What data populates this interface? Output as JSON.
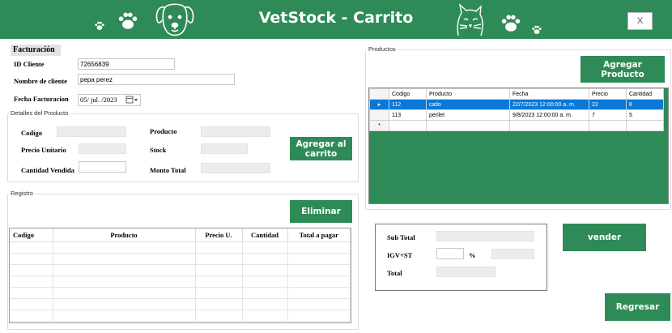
{
  "header": {
    "title": "VetStock - Carrito",
    "close_label": "X",
    "colors": {
      "accent": "#2e8b57",
      "selection": "#0a78d7"
    },
    "icons": [
      "paw-icon",
      "dog-face-icon",
      "cat-face-icon"
    ]
  },
  "facturacion": {
    "heading": "Facturación",
    "id_cliente_label": "ID Cliente",
    "id_cliente_value": "72656839",
    "nombre_label": "Nombre de cliente",
    "nombre_value": "pepa perez",
    "fecha_label": "Fecha Facturacion",
    "fecha_value": "05/ jul. /2023"
  },
  "detalles": {
    "group_title": "Detalles del Producto",
    "codigo_label": "Codigo",
    "precio_label": "Precio Unitario",
    "cantidad_label": "Cantidad Vendida",
    "producto_label": "Producto",
    "stock_label": "Stock",
    "monto_label": "Monto Total",
    "agregar_carrito_label": "Agregar al carrito"
  },
  "registro": {
    "group_title": "Registro",
    "eliminar_label": "Eliminar",
    "columns": [
      "Codigo",
      "Producto",
      "Precio U.",
      "Cantidad",
      "Total a pagar"
    ]
  },
  "productos": {
    "group_title": "Productos",
    "agregar_label": "Agregar Producto",
    "columns": [
      "Codigo",
      "Producto",
      "Fecha",
      "Precio",
      "Cantidad"
    ],
    "rows": [
      {
        "codigo": "112",
        "producto": "catlo",
        "fecha": "22/7/2023 12:00:00 a. m.",
        "precio": "22",
        "cantidad": "8",
        "marker": "▸"
      },
      {
        "codigo": "113",
        "producto": "perilet",
        "fecha": "9/8/2023 12:00:00 a. m.",
        "precio": "7",
        "cantidad": "5",
        "marker": ""
      }
    ],
    "new_row_marker": "*"
  },
  "totales": {
    "subtotal_label": "Sub Total",
    "igv_label": "IGV+ST",
    "percent_label": "%",
    "total_label": "Total"
  },
  "actions": {
    "vender_label": "vender",
    "regresar_label": "Regresar"
  }
}
